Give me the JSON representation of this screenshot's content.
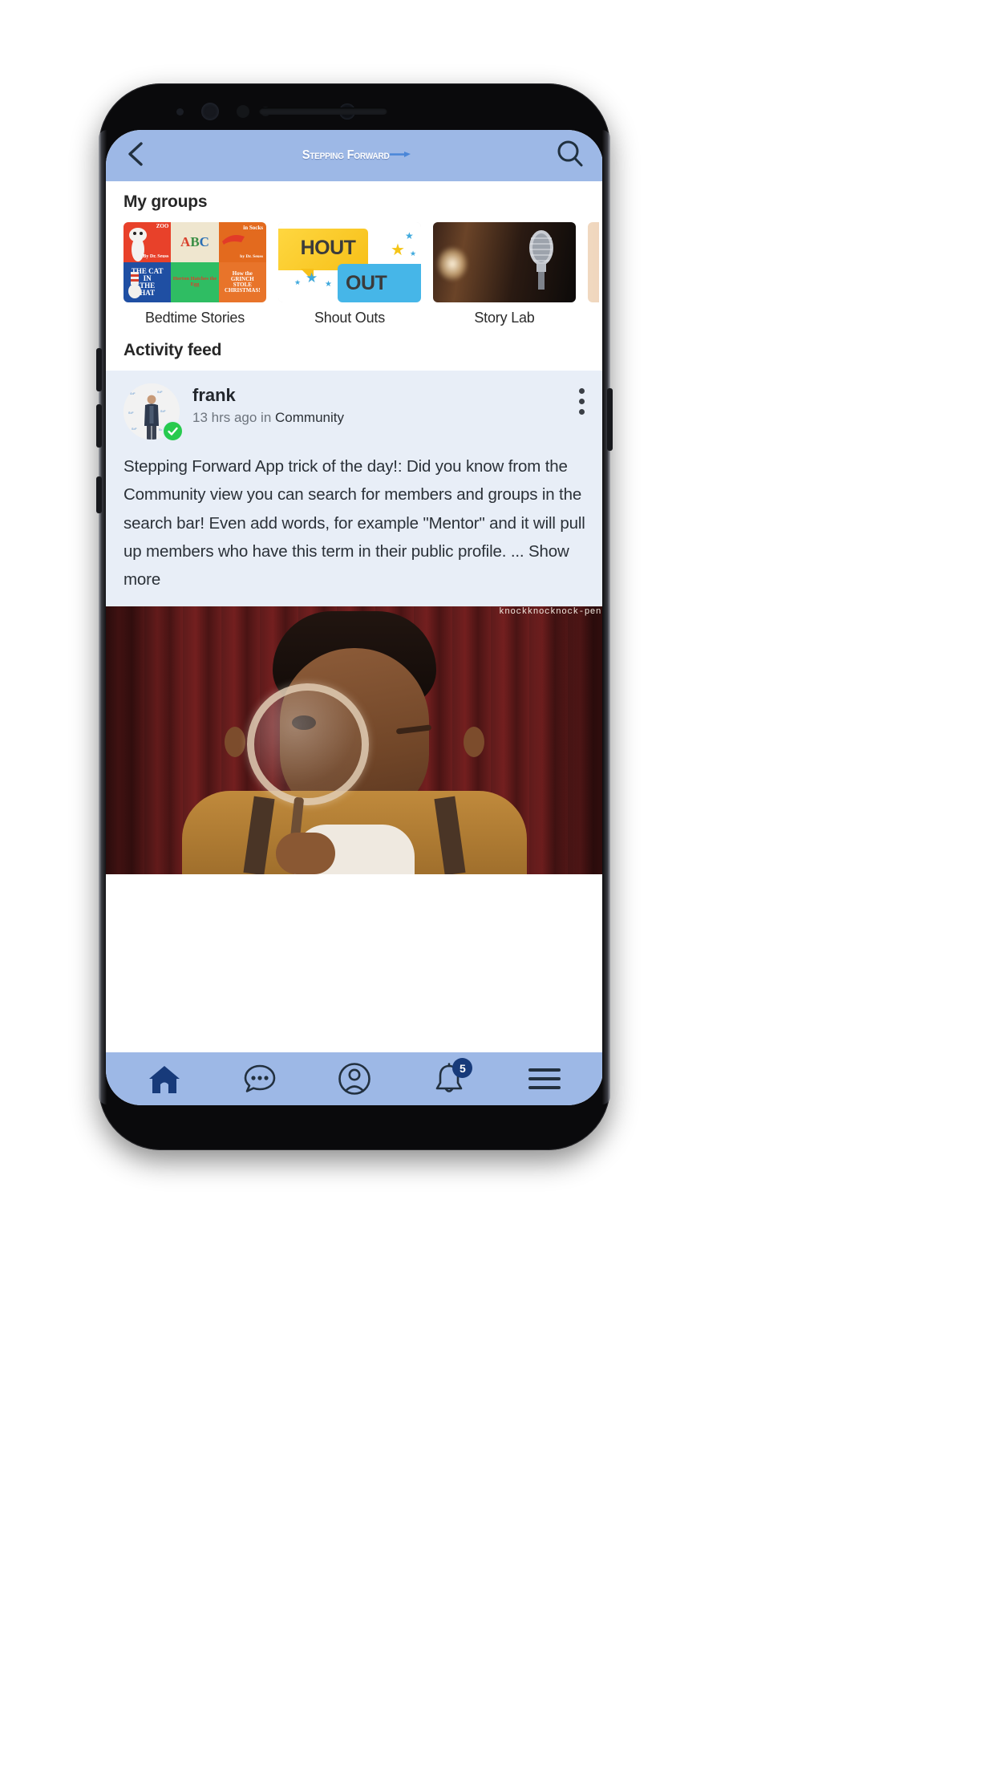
{
  "app": {
    "brand_name": "Stepping Forward",
    "header": {
      "back_icon": "chevron-left-icon",
      "search_icon": "search-icon"
    }
  },
  "groups_section": {
    "title": "My groups",
    "items": [
      {
        "label": "Bedtime Stories",
        "thumb": "dr-seuss-book-collage",
        "book_titles": [
          "ZOO  By Dr. Seuss",
          "ABC",
          "in Socks  by Dr. Seuss",
          "THE CAT IN THE HAT",
          "Horton Hatches the Egg",
          "How the Grinch Stole Christmas!"
        ]
      },
      {
        "label": "Shout Outs",
        "thumb": "shout-out-speech-bubbles",
        "graphic_text_1": "HOUT",
        "graphic_text_2": "OUT"
      },
      {
        "label": "Story Lab",
        "thumb": "vintage-microphone-photo"
      }
    ]
  },
  "feed": {
    "title": "Activity feed",
    "post": {
      "author": "frank",
      "verified": true,
      "time_ago": "13 hrs ago in ",
      "group": "Community",
      "menu_icon": "more-vertical-icon",
      "body": "Stepping Forward App trick of the day!: Did you know from the Community view you can search for members and groups in the search bar! Even add words, for example \"Mentor\" and it will pull up members who have this term in their public profile.",
      "show_more": "... Show more",
      "image": {
        "description": "man-winking-through-magnifying-glass-meme",
        "watermark": "knockknocknock-pen"
      }
    }
  },
  "bottom_nav": {
    "items": [
      {
        "name": "home",
        "icon": "home-icon",
        "active": true,
        "badge": null
      },
      {
        "name": "messages",
        "icon": "chat-bubble-icon",
        "active": false,
        "badge": null
      },
      {
        "name": "profile",
        "icon": "person-circle-icon",
        "active": false,
        "badge": null
      },
      {
        "name": "notifications",
        "icon": "bell-icon",
        "active": false,
        "badge": "5"
      },
      {
        "name": "menu",
        "icon": "hamburger-menu-icon",
        "active": false,
        "badge": null
      }
    ]
  },
  "colors": {
    "header_blue": "#9db8e6",
    "nav_active_navy": "#173a7a",
    "post_bg": "#e8eef7",
    "verified_green": "#27ca4e",
    "text_dark": "#2b3138"
  }
}
